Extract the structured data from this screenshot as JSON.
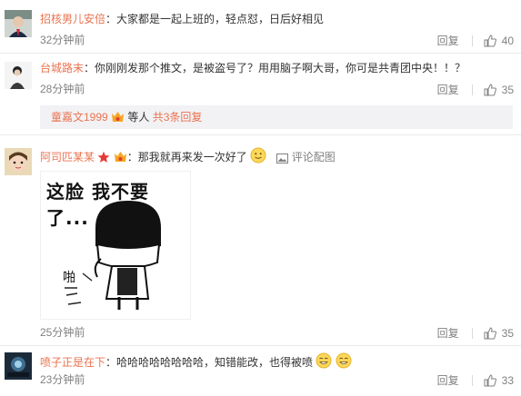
{
  "comments": [
    {
      "username": "招核男儿安倍",
      "text": "大家都是一起上班的，轻点怼，日后好相见",
      "time": "32分钟前",
      "reply_label": "回复",
      "likes": "40"
    },
    {
      "username": "台城路末",
      "text": "你刚刚发那个推文，是被盗号了？用用脑子啊大哥，你可是共青团中央！！？",
      "time": "28分钟前",
      "reply_label": "回复",
      "likes": "35",
      "subreply": {
        "user": "童嘉文1999",
        "middle": "等人",
        "count": "共3条回复"
      }
    },
    {
      "username": "阿司匹某某",
      "text": "那我就再来发一次好了",
      "review_link": "评论配图",
      "meme_caption": "这脸 我不要了...",
      "meme_sound": "啪",
      "time": "25分钟前",
      "reply_label": "回复",
      "likes": "35"
    },
    {
      "username": "喷子正是在下",
      "text": "哈哈哈哈哈哈哈哈，知错能改，也得被喷",
      "time": "23分钟前",
      "reply_label": "回复",
      "likes": "33"
    }
  ],
  "colors": {
    "username": "#eb7350",
    "text": "#333333",
    "meta": "#808080",
    "subreply_bg": "#f2f2f5"
  }
}
